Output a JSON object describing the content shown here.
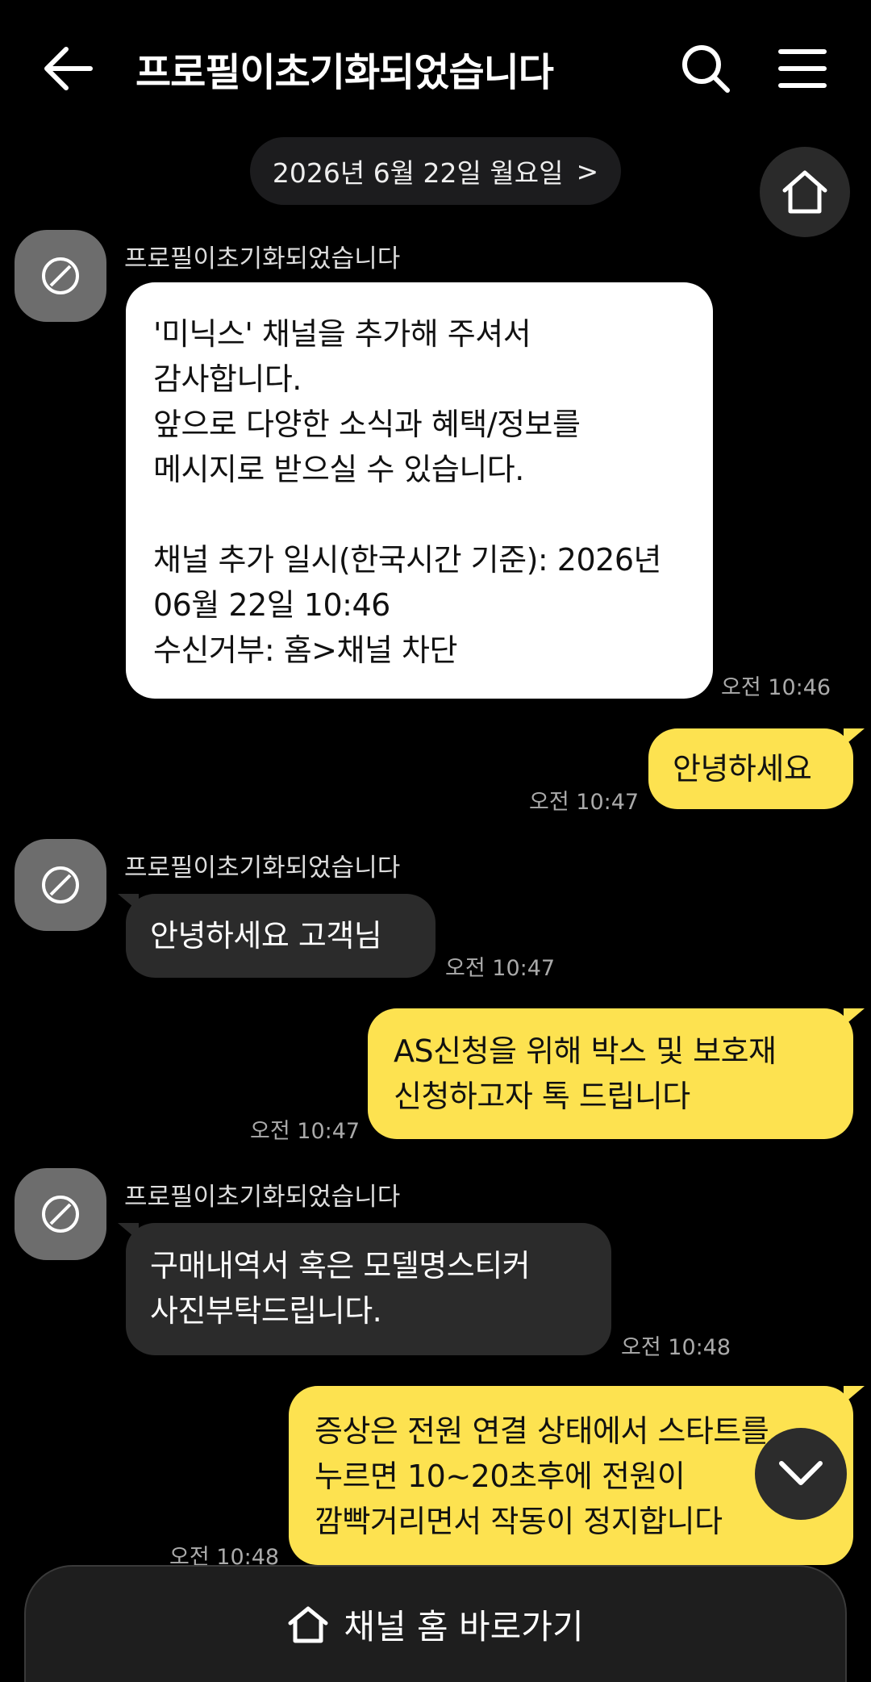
{
  "header": {
    "title": "프로필이초기화되었습니다",
    "back_icon": "arrow-left-icon",
    "search_icon": "search-icon",
    "menu_icon": "hamburger-menu-icon"
  },
  "date_pill": {
    "label": "2026년 6월 22일 월요일",
    "chevron": ">"
  },
  "messages": [
    {
      "type": "received",
      "sender": "프로필이초기화되었습니다",
      "text": "'미닉스' 채널을 추가해 주셔서\n감사합니다.\n앞으로 다양한 소식과 혜택/정보를\n메시지로 받으실 수 있습니다.\n\n채널 추가 일시(한국시간 기준): 2026년\n06월 22일 10:46\n수신거부: 홈>채널 차단",
      "time": "오전 10:46"
    },
    {
      "type": "sent",
      "text": "안녕하세요",
      "time": "오전 10:47"
    },
    {
      "type": "received",
      "sender": "프로필이초기화되었습니다",
      "text": "안녕하세요 고객님",
      "time": "오전 10:47"
    },
    {
      "type": "sent",
      "text": "AS신청을 위해 박스 및 보호재\n신청하고자 톡 드립니다",
      "time": "오전 10:47"
    },
    {
      "type": "received",
      "sender": "프로필이초기화되었습니다",
      "text": "구매내역서 혹은 모델명스티커\n사진부탁드립니다.",
      "time": "오전 10:48"
    },
    {
      "type": "sent",
      "text": "증상은 전원 연결 상태에서 스타트를\n누르면 10~20초후에 전원이\n깜빡거리면서 작동이 정지합니다",
      "time": "오전 10:48"
    }
  ],
  "bottom_bar": {
    "label": "채널 홈 바로가기"
  },
  "colors": {
    "background": "#000000",
    "sent_bubble": "#fde250",
    "received_bubble": "#2b2b2b",
    "notice_bubble": "#ffffff"
  }
}
